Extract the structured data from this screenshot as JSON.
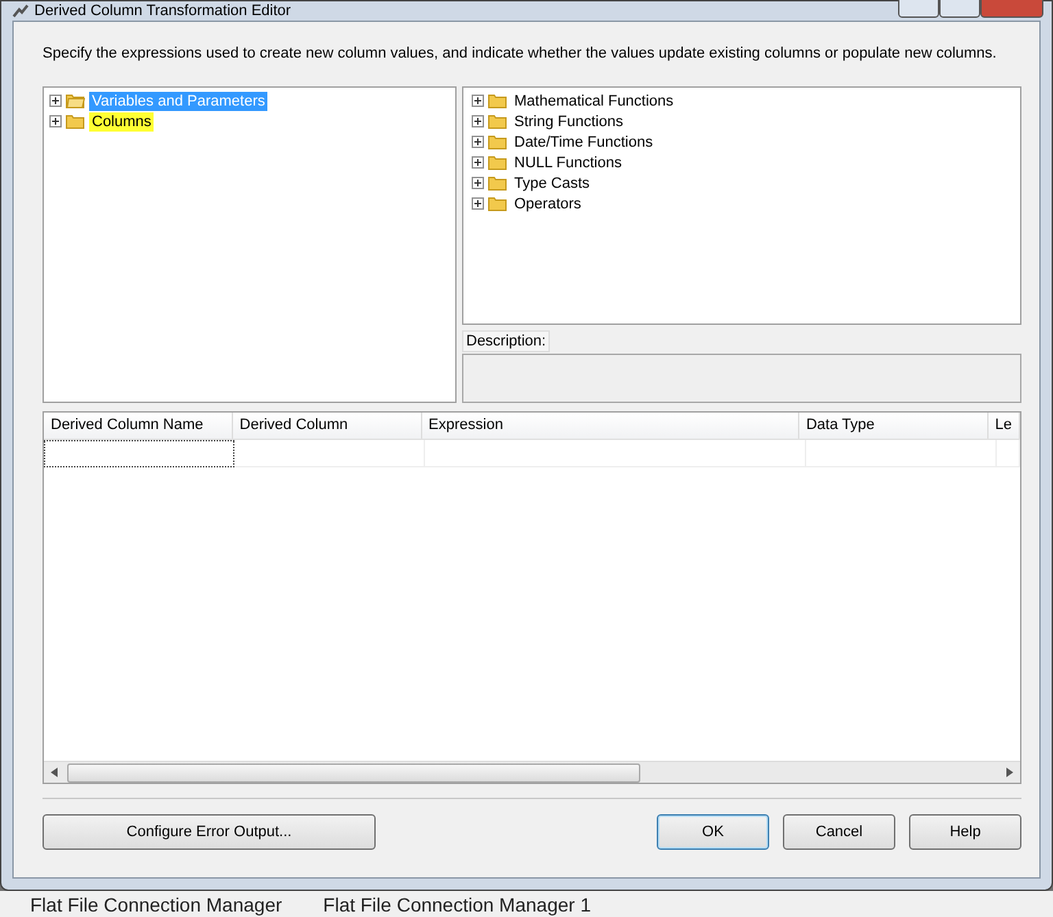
{
  "window": {
    "title": "Derived Column Transformation Editor"
  },
  "instructions": "Specify the expressions used to create new column values, and indicate whether the values update existing columns or populate new columns.",
  "input_tree": [
    {
      "label": "Variables and Parameters",
      "expanded": false,
      "selected": true,
      "highlighted": false
    },
    {
      "label": "Columns",
      "expanded": false,
      "selected": false,
      "highlighted": true
    }
  ],
  "function_tree": [
    {
      "label": "Mathematical Functions",
      "expanded": false
    },
    {
      "label": "String Functions",
      "expanded": false
    },
    {
      "label": "Date/Time Functions",
      "expanded": false
    },
    {
      "label": "NULL Functions",
      "expanded": false
    },
    {
      "label": "Type Casts",
      "expanded": false
    },
    {
      "label": "Operators",
      "expanded": false
    }
  ],
  "description": {
    "label": "Description:"
  },
  "grid": {
    "columns": [
      "Derived Column Name",
      "Derived Column",
      "Expression",
      "Data Type",
      "Le"
    ]
  },
  "buttons": [
    {
      "label": "Configure Error Output...",
      "default": false
    },
    {
      "label": "OK",
      "default": true
    },
    {
      "label": "Cancel",
      "default": false
    },
    {
      "label": "Help",
      "default": false
    }
  ],
  "background": {
    "items": [
      "Flat File Connection Manager",
      "Flat File Connection Manager 1"
    ]
  }
}
